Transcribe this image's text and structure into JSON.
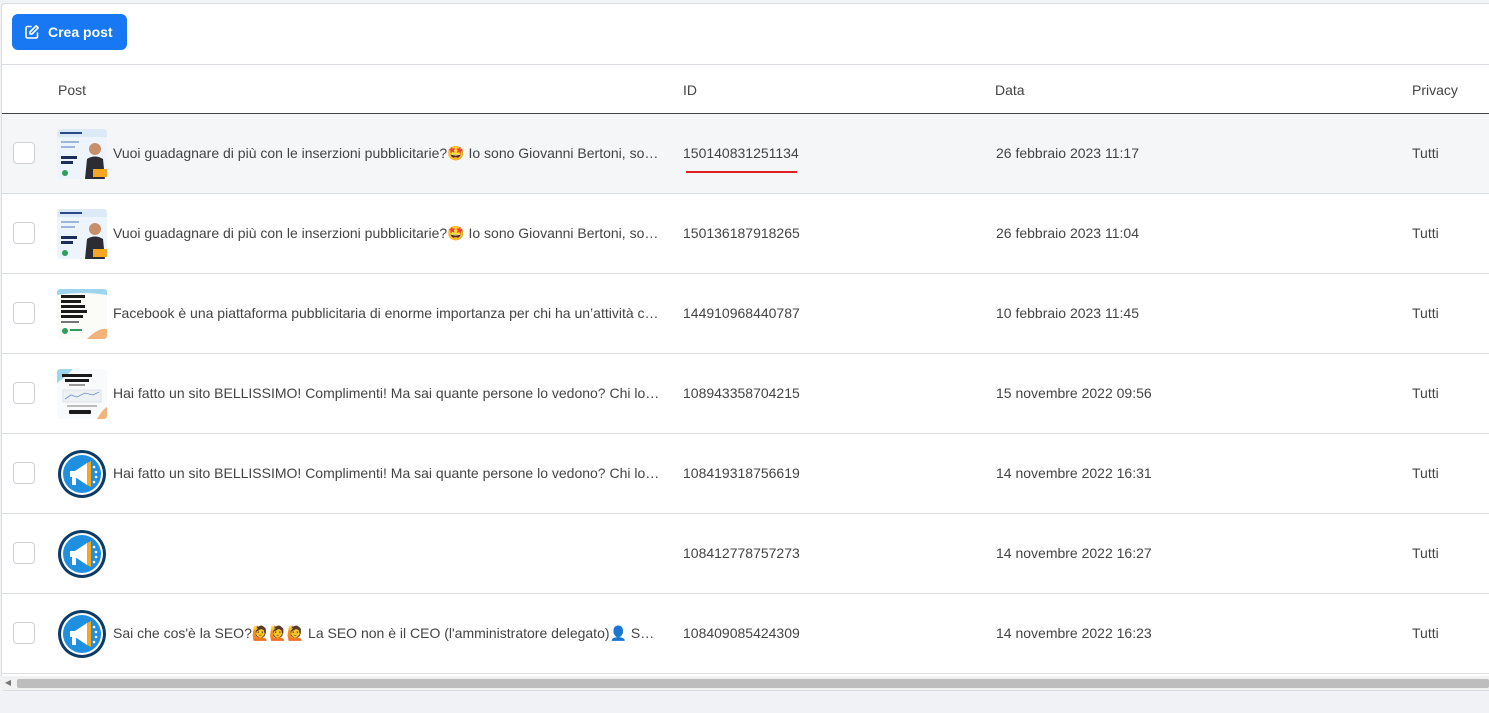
{
  "toolbar": {
    "create_label": "Crea post",
    "create_icon": "edit-icon",
    "accent": "#1877f2"
  },
  "columns": {
    "post": "Post",
    "id": "ID",
    "date": "Data",
    "privacy": "Privacy"
  },
  "rows": [
    {
      "thumb": "ad-earnings-image",
      "text": "Vuoi guadagnare di più con le inserzioni pubblicitarie?🤩 Io sono Giovanni Bertoni, sono un consulente",
      "id": "150140831251134",
      "date": "26 febbraio 2023 11:17",
      "privacy": "Tutti"
    },
    {
      "thumb": "ad-earnings-image",
      "text": "Vuoi guadagnare di più con le inserzioni pubblicitarie?🤩 Io sono Giovanni Bertoni, sono un consulente",
      "id": "150136187918265",
      "date": "26 febbraio 2023 11:04",
      "privacy": "Tutti"
    },
    {
      "thumb": "facebook-campaigns-image",
      "text": "Facebook è una piattaforma pubblicitaria di enorme importanza per chi ha un’attività commerciale",
      "id": "144910968440787",
      "date": "10 febbraio 2023 11:45",
      "privacy": "Tutti"
    },
    {
      "thumb": "case-study-image",
      "text": "Hai fatto un sito BELLISSIMO! Complimenti! Ma sai quante persone lo vedono? Chi lo sta cercando",
      "id": "108943358704215",
      "date": "15 novembre 2022 09:56",
      "privacy": "Tutti"
    },
    {
      "thumb": "megaphone-logo",
      "text": "Hai fatto un sito BELLISSIMO! Complimenti! Ma sai quante persone lo vedono? Chi lo sta cercando",
      "id": "108419318756619",
      "date": "14 novembre 2022 16:31",
      "privacy": "Tutti"
    },
    {
      "thumb": "megaphone-logo",
      "text": "",
      "id": "108412778757273",
      "date": "14 novembre 2022 16:27",
      "privacy": "Tutti"
    },
    {
      "thumb": "megaphone-logo",
      "text": "Sai che cos'è la SEO?🙋🙋🙋 La SEO non è il CEO (l'amministratore delegato)👤 SEO è l'acronimo di",
      "id": "108409085424309",
      "date": "14 novembre 2022 16:23",
      "privacy": "Tutti"
    }
  ]
}
